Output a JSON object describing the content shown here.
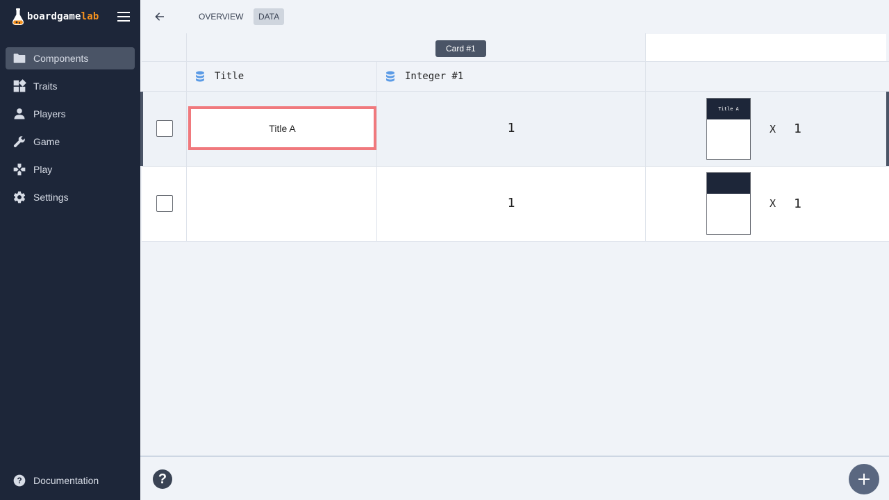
{
  "app": {
    "brand_main": "boardgame",
    "brand_accent": "lab",
    "accent_color": "#f6921e",
    "sidebar_bg": "#1d2639"
  },
  "sidebar": {
    "items": [
      {
        "label": "Components",
        "icon": "folder-icon",
        "active": true
      },
      {
        "label": "Traits",
        "icon": "dashboard-icon",
        "active": false
      },
      {
        "label": "Players",
        "icon": "person-icon",
        "active": false
      },
      {
        "label": "Game",
        "icon": "wrench-icon",
        "active": false
      },
      {
        "label": "Play",
        "icon": "gamepad-icon",
        "active": false
      },
      {
        "label": "Settings",
        "icon": "gear-icon",
        "active": false
      }
    ],
    "documentation_label": "Documentation"
  },
  "topbar": {
    "tabs": [
      {
        "label": "OVERVIEW",
        "active": false
      },
      {
        "label": "DATA",
        "active": true
      }
    ]
  },
  "table": {
    "group_label": "Card #1",
    "columns": [
      {
        "name": "Title",
        "icon": "database-icon"
      },
      {
        "name": "Integer #1",
        "icon": "database-icon"
      }
    ],
    "rows": [
      {
        "title": "Title A",
        "integer": "1",
        "preview_title": "Title A",
        "x_label": "X",
        "quantity": "1",
        "selected": false,
        "editing": true
      },
      {
        "title": "",
        "integer": "1",
        "preview_title": "",
        "x_label": "X",
        "quantity": "1",
        "selected": false,
        "editing": false
      }
    ]
  },
  "bottombar": {
    "help_label": "?"
  }
}
